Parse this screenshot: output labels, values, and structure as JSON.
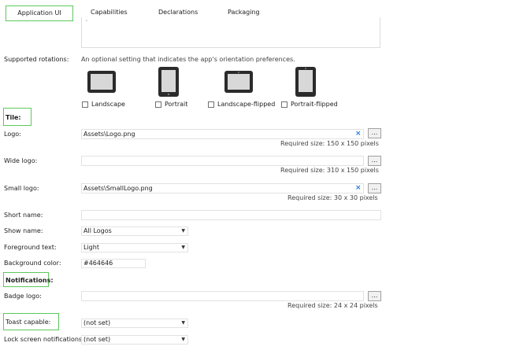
{
  "tabs": [
    "Application UI",
    "Capabilities",
    "Declarations",
    "Packaging"
  ],
  "top_field": {
    "value": ""
  },
  "rotations": {
    "label": "Supported rotations:",
    "hint": "An optional setting that indicates the app's orientation preferences.",
    "options": [
      {
        "label": "Landscape",
        "checked": false,
        "icon": "tablet-landscape-icon"
      },
      {
        "label": "Portrait",
        "checked": false,
        "icon": "tablet-portrait-icon"
      },
      {
        "label": "Landscape-flipped",
        "checked": false,
        "icon": "tablet-landscape-flipped-icon"
      },
      {
        "label": "Portrait-flipped",
        "checked": false,
        "icon": "tablet-portrait-flipped-icon"
      }
    ]
  },
  "tile": {
    "heading": "Tile:",
    "logo": {
      "label": "Logo:",
      "value": "Assets\\Logo.png",
      "required": "Required size: 150 x 150 pixels",
      "clear": "×",
      "browse": "..."
    },
    "wide_logo": {
      "label": "Wide logo:",
      "value": "",
      "required": "Required size: 310 x 150 pixels",
      "browse": "..."
    },
    "small_logo": {
      "label": "Small logo:",
      "value": "Assets\\SmallLogo.png",
      "required": "Required size: 30 x 30 pixels",
      "clear": "×",
      "browse": "..."
    },
    "short_name": {
      "label": "Short name:",
      "value": ""
    },
    "show_name": {
      "label": "Show name:",
      "value": "All Logos"
    },
    "foreground_text": {
      "label": "Foreground text:",
      "value": "Light"
    },
    "background_color": {
      "label": "Background color:",
      "value": "#464646"
    }
  },
  "notifications": {
    "heading": "Notifications:",
    "badge_logo": {
      "label": "Badge logo:",
      "value": "",
      "required": "Required size: 24 x 24 pixels",
      "browse": "..."
    },
    "toast_capable": {
      "label": "Toast capable:",
      "value": "(not set)"
    },
    "lock_screen": {
      "label": "Lock screen notifications:",
      "value": "(not set)"
    }
  },
  "colors": {
    "highlight": "#5cc95c",
    "clear_x": "#2a7bd4"
  }
}
